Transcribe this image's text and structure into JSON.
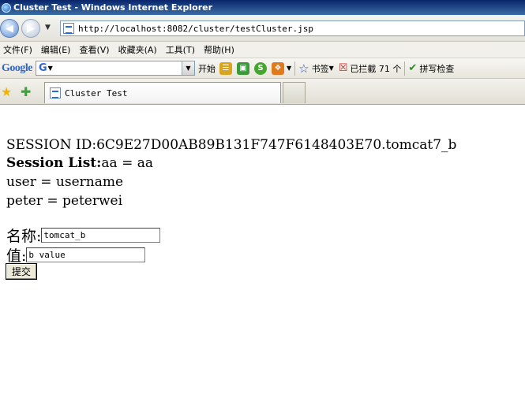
{
  "window": {
    "title": "Cluster Test - Windows Internet Explorer"
  },
  "address": {
    "url": "http://localhost:8082/cluster/testCluster.jsp"
  },
  "menu": [
    {
      "label": "文件(F)"
    },
    {
      "label": "编辑(E)"
    },
    {
      "label": "查看(V)"
    },
    {
      "label": "收藏夹(A)"
    },
    {
      "label": "工具(T)"
    },
    {
      "label": "帮助(H)"
    }
  ],
  "google_toolbar": {
    "logo": "Google",
    "start_label": "开始",
    "bookmarks_label": "书签",
    "blocked_label": "已拦截 71 个",
    "spellcheck_label": "拼写检查"
  },
  "tabs": {
    "active_tab_title": "Cluster Test"
  },
  "page": {
    "session_id_label": "SESSION ID:",
    "session_id_value": "6C9E27D00AB89B131F747F6148403E70.tomcat7_b",
    "session_list_label": "Session List:",
    "session_entries": [
      "aa = aa",
      "user = username",
      "peter = peterwei"
    ],
    "name_label": "名称:",
    "name_value": "tomcat_b",
    "value_label": "值:",
    "value_value": "b value",
    "submit_label": "提交"
  },
  "colors": {
    "titlebar": "#0a246a",
    "chrome": "#ece9d8"
  }
}
